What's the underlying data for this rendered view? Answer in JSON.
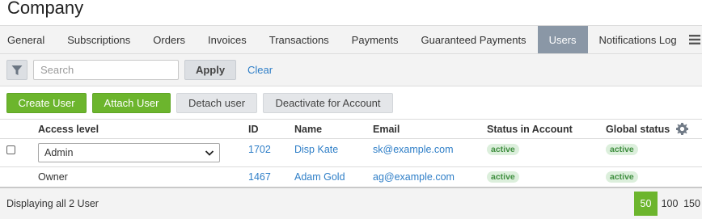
{
  "page": {
    "title": "Company"
  },
  "tabs": [
    {
      "label": "General"
    },
    {
      "label": "Subscriptions"
    },
    {
      "label": "Orders"
    },
    {
      "label": "Invoices"
    },
    {
      "label": "Transactions"
    },
    {
      "label": "Payments"
    },
    {
      "label": "Guaranteed Payments"
    },
    {
      "label": "Users",
      "active": true
    },
    {
      "label": "Notifications Log"
    }
  ],
  "filter": {
    "search_placeholder": "Search",
    "search_value": "",
    "apply_label": "Apply",
    "clear_label": "Clear"
  },
  "actions": {
    "create": "Create User",
    "attach": "Attach User",
    "detach": "Detach user",
    "deactivate": "Deactivate for Account"
  },
  "table": {
    "headers": {
      "access_level": "Access level",
      "id": "ID",
      "name": "Name",
      "email": "Email",
      "status_account": "Status in Account",
      "global_status": "Global status"
    },
    "rows": [
      {
        "access_level": "Admin",
        "id": "1702",
        "name": "Disp Kate",
        "email": "sk@example.com",
        "status_account": "active",
        "global_status": "active"
      },
      {
        "access_level": "Owner",
        "id": "1467",
        "name": "Adam Gold",
        "email": "ag@example.com",
        "status_account": "active",
        "global_status": "active"
      }
    ]
  },
  "footer": {
    "summary": "Displaying all 2 User",
    "page_sizes": [
      "50",
      "100",
      "150"
    ],
    "selected_page_size": "50"
  },
  "colors": {
    "accent_green": "#6cb52d",
    "active_tab": "#8a97a6",
    "link": "#2e7ec7",
    "badge_bg": "#dcefdc",
    "badge_text": "#3f8e3f"
  },
  "icons": {
    "filter": "filter-icon",
    "menu": "hamburger-menu-icon",
    "settings": "gear-icon",
    "dropdown": "chevron-down-icon"
  }
}
